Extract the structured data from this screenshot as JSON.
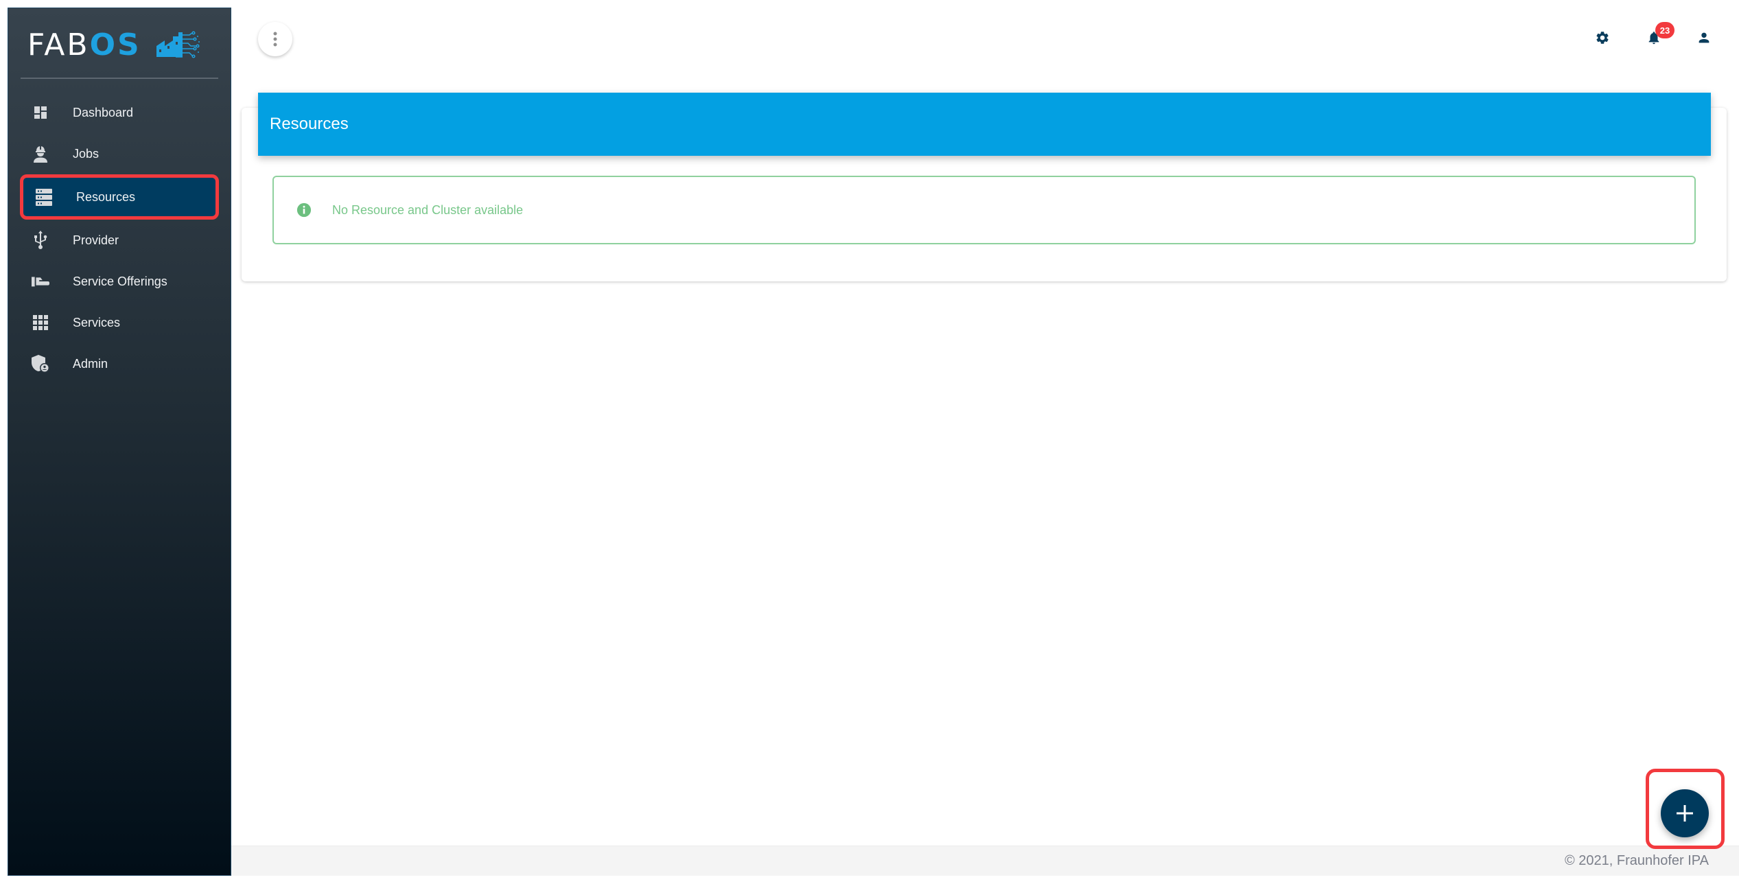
{
  "app": {
    "logo_text_main": "FAB",
    "logo_text_accent": "OS",
    "logo_graphic": "factory-circuit-logo"
  },
  "sidebar": {
    "items": [
      {
        "label": "Dashboard",
        "icon": "dashboard-icon",
        "active": false
      },
      {
        "label": "Jobs",
        "icon": "engineer-icon",
        "active": false
      },
      {
        "label": "Resources",
        "icon": "server-stack-icon",
        "active": true
      },
      {
        "label": "Provider",
        "icon": "usb-icon",
        "active": false
      },
      {
        "label": "Service Offerings",
        "icon": "hand-offer-icon",
        "active": false
      },
      {
        "label": "Services",
        "icon": "apps-grid-icon",
        "active": false
      },
      {
        "label": "Admin",
        "icon": "admin-shield-icon",
        "active": false
      }
    ]
  },
  "topbar": {
    "menu_icon": "more-vertical-icon",
    "settings_icon": "gear-icon",
    "notifications_icon": "bell-icon",
    "notifications_count": "23",
    "account_icon": "user-icon"
  },
  "main": {
    "card_title": "Resources",
    "alert": {
      "icon": "info-icon",
      "text": "No Resource and Cluster available"
    },
    "fab_icon": "plus-icon"
  },
  "footer": {
    "text": "© 2021, Fraunhofer IPA"
  },
  "colors": {
    "accent_blue": "#03a0e2",
    "active_nav": "#003c60",
    "fab": "#003a5d",
    "highlight_red": "#f23a3e",
    "alert_green": "#78c78a",
    "badge_red": "#f23a3e",
    "icon_navy": "#0b3d5c"
  }
}
